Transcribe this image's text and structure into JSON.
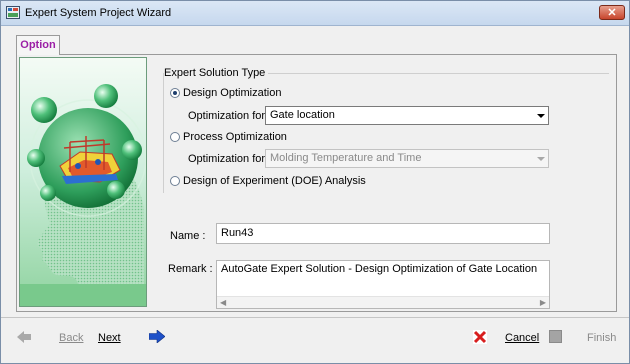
{
  "window": {
    "title": "Expert System Project Wizard",
    "close_label": "✕"
  },
  "tabs": [
    {
      "label": "Option",
      "active": true
    }
  ],
  "expert_solution": {
    "group_title": "Expert Solution Type",
    "options": [
      {
        "label": "Design Optimization",
        "selected": true
      },
      {
        "label": "Process Optimization",
        "selected": false
      },
      {
        "label": "Design of Experiment (DOE) Analysis",
        "selected": false
      }
    ],
    "design_optimization_for": {
      "label": "Optimization for",
      "value": "Gate location",
      "enabled": true
    },
    "process_optimization_for": {
      "label": "Optimization for",
      "value": "Molding Temperature and Time",
      "enabled": false
    }
  },
  "name_field": {
    "label": "Name :",
    "value": "Run43"
  },
  "remark_field": {
    "label": "Remark :",
    "value": "AutoGate Expert Solution - Design Optimization of Gate Location"
  },
  "footer": {
    "back_label": "Back",
    "next_label": "Next",
    "cancel_label": "Cancel",
    "finish_label": "Finish"
  },
  "icons": {
    "app": "wizard-app-icon",
    "back": "arrow-left-icon",
    "next": "arrow-right-icon",
    "cancel": "red-x-icon",
    "finish": "finish-square-icon"
  },
  "colors": {
    "tab_text": "#9b1fa6",
    "hero_green": "#2e9e5b",
    "next_arrow": "#1e50c8",
    "cancel_red": "#d81e1e"
  }
}
